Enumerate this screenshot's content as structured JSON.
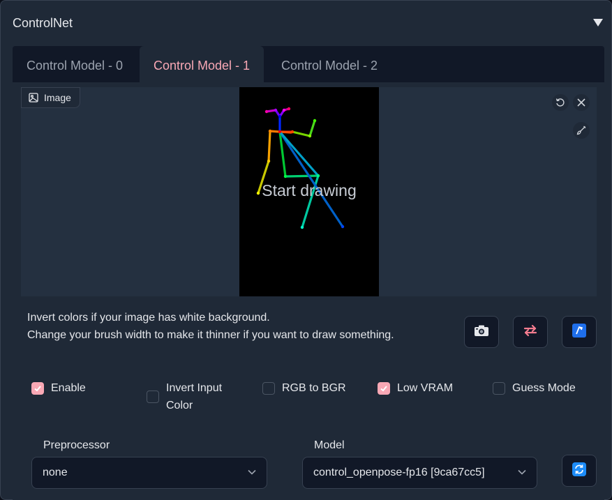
{
  "accordion": {
    "title": "ControlNet"
  },
  "tabs": [
    {
      "label": "Control Model - 0"
    },
    {
      "label": "Control Model - 1"
    },
    {
      "label": "Control Model - 2"
    }
  ],
  "image_panel": {
    "badge_label": "Image",
    "canvas_placeholder": "Start drawing"
  },
  "help": {
    "line1": "Invert colors if your image has white background.",
    "line2": "Change your brush width to make it thinner if you want to draw something."
  },
  "tool_buttons": [
    "camera-icon",
    "swap-arrows-icon",
    "send-dimensions-icon"
  ],
  "checkboxes": {
    "enable": {
      "label": "Enable",
      "checked": true
    },
    "invert": {
      "label": "Invert Input Color",
      "checked": false
    },
    "rgb_bgr": {
      "label": "RGB to BGR",
      "checked": false
    },
    "low_vram": {
      "label": "Low VRAM",
      "checked": true
    },
    "guess_mode": {
      "label": "Guess Mode",
      "checked": false
    }
  },
  "preprocessor": {
    "label": "Preprocessor",
    "value": "none"
  },
  "model": {
    "label": "Model",
    "value": "control_openpose-fp16 [9ca67cc5]"
  },
  "colors": {
    "accent": "#f9a8b5",
    "refresh_icon": "#3b82f6"
  }
}
